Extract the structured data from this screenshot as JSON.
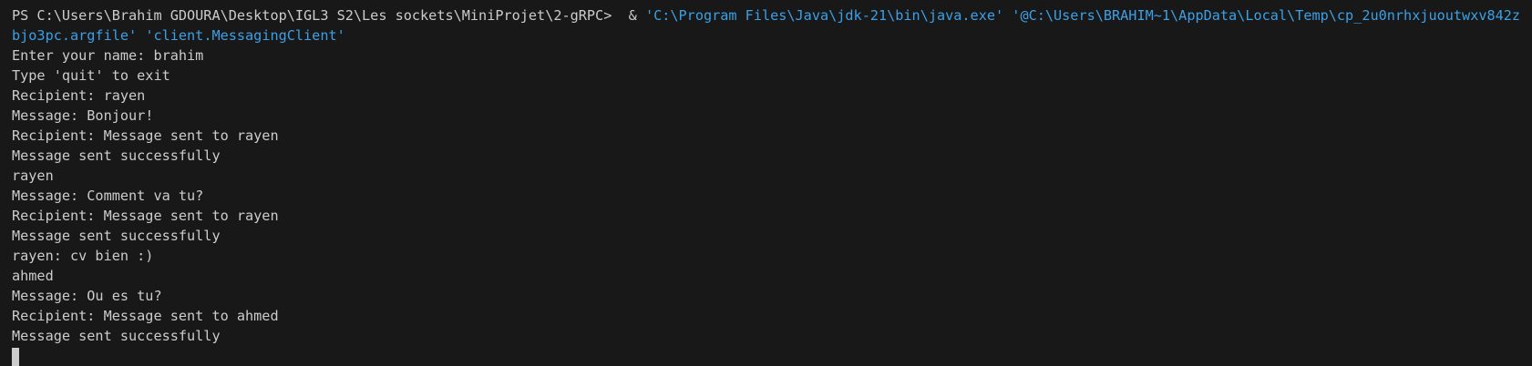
{
  "terminal": {
    "prompt": "PS C:\\Users\\Brahim GDOURA\\Desktop\\IGL3 S2\\Les sockets\\MiniProjet\\2-gRPC>",
    "call_operator": "&",
    "java_path": "'C:\\Program Files\\Java\\jdk-21\\bin\\java.exe'",
    "argfile": "'@C:\\Users\\BRAHIM~1\\AppData\\Local\\Temp\\cp_2u0nrhxjuoutwxv842zbjo3pc.argfile'",
    "main_class": "'client.MessagingClient'",
    "output_lines": [
      "Enter your name: brahim",
      "Type 'quit' to exit",
      "Recipient: rayen",
      "Message: Bonjour!",
      "Recipient: Message sent to rayen",
      "Message sent successfully",
      "rayen",
      "Message: Comment va tu?",
      "Recipient: Message sent to rayen",
      "Message sent successfully",
      "rayen: cv bien :)",
      "ahmed",
      "Message: Ou es tu?",
      "Recipient: Message sent to ahmed",
      "Message sent successfully"
    ],
    "colors": {
      "background": "#181818",
      "text": "#cccccc",
      "string": "#3ba0e6"
    }
  }
}
